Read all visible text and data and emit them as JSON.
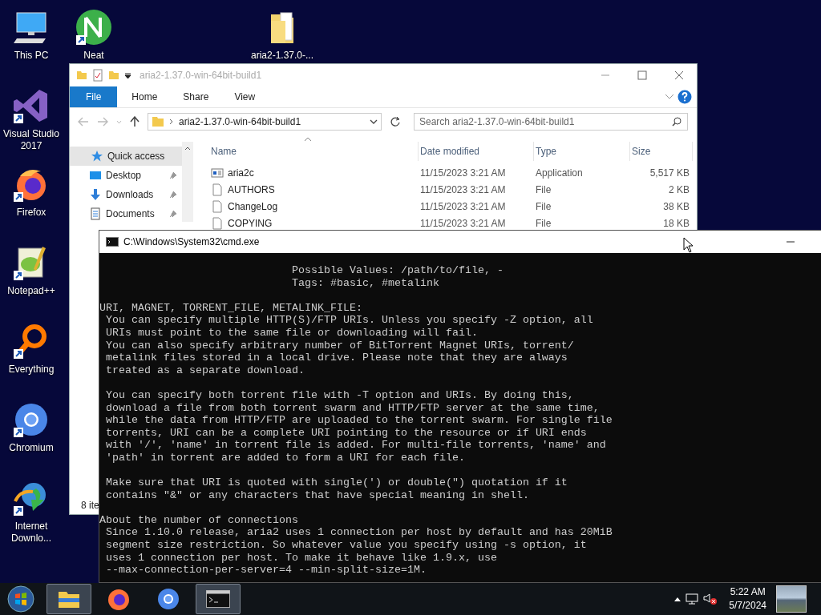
{
  "desktop": {
    "column_icons": [
      {
        "label": "This PC",
        "kind": "pc",
        "shortcut": false
      },
      {
        "label": "Visual Studio 2017",
        "kind": "vs",
        "shortcut": true
      },
      {
        "label": "Firefox",
        "kind": "firefox",
        "shortcut": true
      },
      {
        "label": "Notepad++",
        "kind": "notepad",
        "shortcut": true
      },
      {
        "label": "Everything",
        "kind": "everything",
        "shortcut": true
      },
      {
        "label": "Chromium",
        "kind": "chromium",
        "shortcut": true
      },
      {
        "label": "Internet Downlo...",
        "kind": "idm",
        "shortcut": true
      }
    ],
    "top_icons": [
      {
        "label": "Neat",
        "kind": "neat",
        "shortcut": true
      },
      {
        "label": "aria2-1.37.0-...",
        "kind": "folder",
        "shortcut": false
      }
    ]
  },
  "explorer": {
    "title": "aria2-1.37.0-win-64bit-build1",
    "ribbon_tabs": [
      {
        "label": "File",
        "selected": true
      },
      {
        "label": "Home",
        "selected": false
      },
      {
        "label": "Share",
        "selected": false
      },
      {
        "label": "View",
        "selected": false
      }
    ],
    "address": "aria2-1.37.0-win-64bit-build1",
    "search": {
      "placeholder": "Search aria2-1.37.0-win-64bit-build1"
    },
    "nav_items": [
      {
        "label": "Quick access",
        "kind": "star",
        "selected": true,
        "pinned": false
      },
      {
        "label": "Desktop",
        "kind": "desktop",
        "selected": false,
        "pinned": true
      },
      {
        "label": "Downloads",
        "kind": "downloads",
        "selected": false,
        "pinned": true
      },
      {
        "label": "Documents",
        "kind": "documents",
        "selected": false,
        "pinned": true
      }
    ],
    "columns": [
      "Name",
      "Date modified",
      "Type",
      "Size"
    ],
    "files": [
      {
        "name": "aria2c",
        "kind": "application",
        "date": "11/15/2023 3:21 AM",
        "type": "Application",
        "size": "5,517 KB"
      },
      {
        "name": "AUTHORS",
        "kind": "file",
        "date": "11/15/2023 3:21 AM",
        "type": "File",
        "size": "2 KB"
      },
      {
        "name": "ChangeLog",
        "kind": "file",
        "date": "11/15/2023 3:21 AM",
        "type": "File",
        "size": "38 KB"
      },
      {
        "name": "COPYING",
        "kind": "file",
        "date": "11/15/2023 3:21 AM",
        "type": "File",
        "size": "18 KB"
      }
    ],
    "status": "8 ite"
  },
  "cmd": {
    "title": "C:\\Windows\\System32\\cmd.exe",
    "blocks": [
      [
        "                              Possible Values: /path/to/file, -",
        "                              Tags: #basic, #metalink"
      ],
      [
        "URI, MAGNET, TORRENT_FILE, METALINK_FILE:",
        " You can specify multiple HTTP(S)/FTP URIs. Unless you specify -Z option, all",
        " URIs must point to the same file or downloading will fail.",
        " You can also specify arbitrary number of BitTorrent Magnet URIs, torrent/",
        " metalink files stored in a local drive. Please note that they are always",
        " treated as a separate download."
      ],
      [
        " You can specify both torrent file with -T option and URIs. By doing this,",
        " download a file from both torrent swarm and HTTP/FTP server at the same time,",
        " while the data from HTTP/FTP are uploaded to the torrent swarm. For single file",
        " torrents, URI can be a complete URI pointing to the resource or if URI ends",
        " with '/', 'name' in torrent file is added. For multi-file torrents, 'name' and",
        " 'path' in torrent are added to form a URI for each file."
      ],
      [
        " Make sure that URI is quoted with single(') or double(\") quotation if it",
        " contains \"&\" or any characters that have special meaning in shell."
      ],
      [
        "About the number of connections",
        " Since 1.10.0 release, aria2 uses 1 connection per host by default and has 20MiB",
        " segment size restriction. So whatever value you specify using -s option, it",
        " uses 1 connection per host. To make it behave like 1.9.x, use",
        " --max-connection-per-server=4 --min-split-size=1M."
      ]
    ]
  },
  "taskbar": {
    "apps": [
      {
        "kind": "explorer",
        "active": true
      },
      {
        "kind": "firefox",
        "active": false
      },
      {
        "kind": "chromium",
        "active": false
      },
      {
        "kind": "cmd",
        "active": true
      }
    ],
    "time": "5:22 AM",
    "date": "5/7/2024"
  }
}
